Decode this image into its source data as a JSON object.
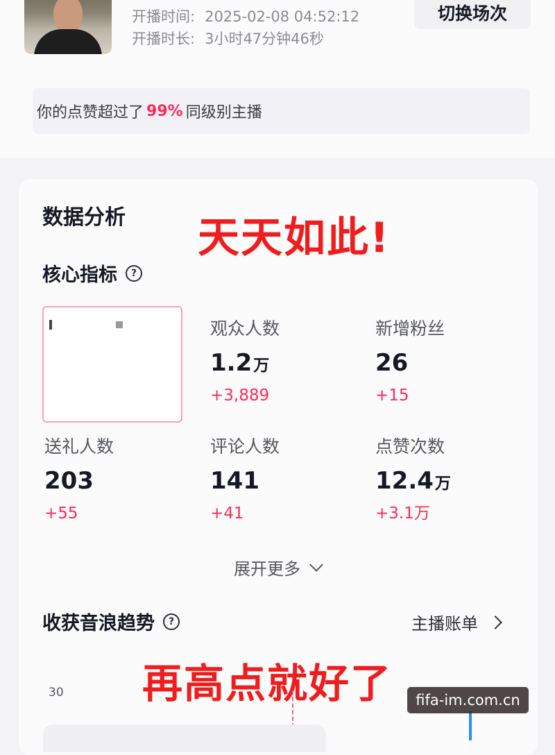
{
  "header": {
    "start_time_label": "开播时间:",
    "start_time_value": "2025-02-08 04:52:12",
    "duration_label": "开播时长:",
    "duration_value": "3小时47分钟46秒",
    "switch_button": "切换场次"
  },
  "compare": {
    "prefix": "你的点赞超过了",
    "percent": "99%",
    "suffix": "同级别主播"
  },
  "analysis": {
    "title": "数据分析",
    "overlay_text": "天天如此!",
    "core_title": "核心指标",
    "help_glyph": "?",
    "metrics": [
      {
        "label": "观众人数",
        "value": "1.2",
        "unit": "万",
        "delta": "+3,889"
      },
      {
        "label": "新增粉丝",
        "value": "26",
        "unit": "",
        "delta": "+15"
      },
      {
        "label": "送礼人数",
        "value": "203",
        "unit": "",
        "delta": "+55"
      },
      {
        "label": "评论人数",
        "value": "141",
        "unit": "",
        "delta": "+41"
      },
      {
        "label": "点赞次数",
        "value": "12.4",
        "unit": "万",
        "delta": "+3.1万"
      }
    ],
    "expand_more": "展开更多"
  },
  "trend": {
    "title": "收获音浪趋势",
    "help_glyph": "?",
    "bill_link": "主播账单",
    "overlay_text": "再高点就好了",
    "y_tick": "30"
  },
  "watermark": "fifa-im.com.cn",
  "colors": {
    "accent": "#fe2c55",
    "overlay_red": "#ef1d1d",
    "chart_blue": "#2a8cf5"
  }
}
